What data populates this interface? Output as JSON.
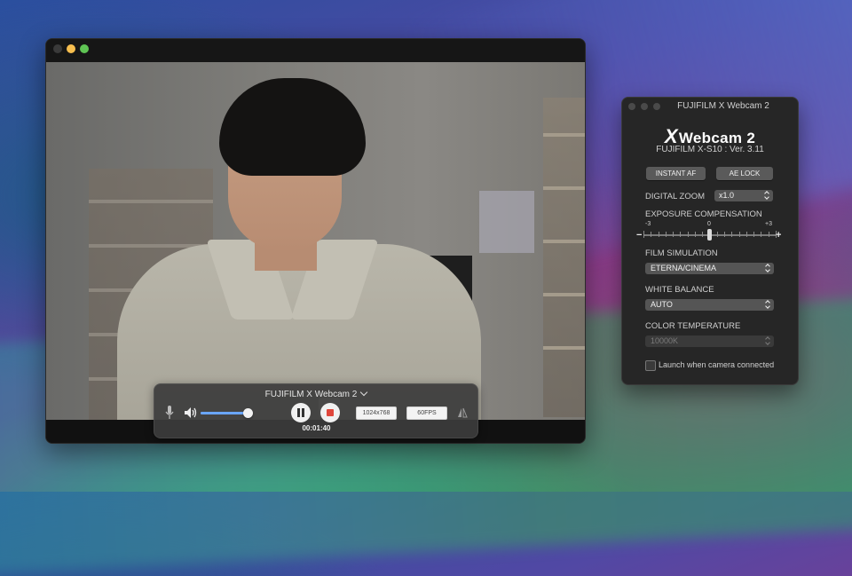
{
  "camera_window": {
    "hud": {
      "device_name": "FUJIFILM X Webcam 2",
      "volume_level": 0.95,
      "elapsed_time": "00:01:40",
      "resolution": "1024x768",
      "framerate": "60FPS"
    }
  },
  "settings_panel": {
    "title": "FUJIFILM X Webcam 2",
    "logo_x": "X",
    "logo_text": "Webcam 2",
    "version": "FUJIFILM  X-S10 : Ver. 3.11",
    "instant_af_label": "INSTANT AF",
    "ae_lock_label": "AE LOCK",
    "digital_zoom_label": "DIGITAL ZOOM",
    "digital_zoom_value": "x1.0",
    "exposure_label": "EXPOSURE COMPENSATION",
    "exposure_min": "-3",
    "exposure_mid": "0",
    "exposure_max": "+3",
    "exposure_minus": "−",
    "exposure_plus": "+",
    "exposure_value": 0,
    "film_sim_label": "FILM SIMULATION",
    "film_sim_value": "ETERNA/CINEMA",
    "white_balance_label": "WHITE BALANCE",
    "white_balance_value": "AUTO",
    "color_temp_label": "COLOR TEMPERATURE",
    "color_temp_value": "10000K",
    "launch_label": "Launch when camera connected",
    "launch_checked": false
  },
  "colors": {
    "volume_fill": "#6aa6ff",
    "stop_red": "#e0463b",
    "traffic_minimize": "#f6be4f",
    "traffic_maximize": "#5fc454"
  }
}
